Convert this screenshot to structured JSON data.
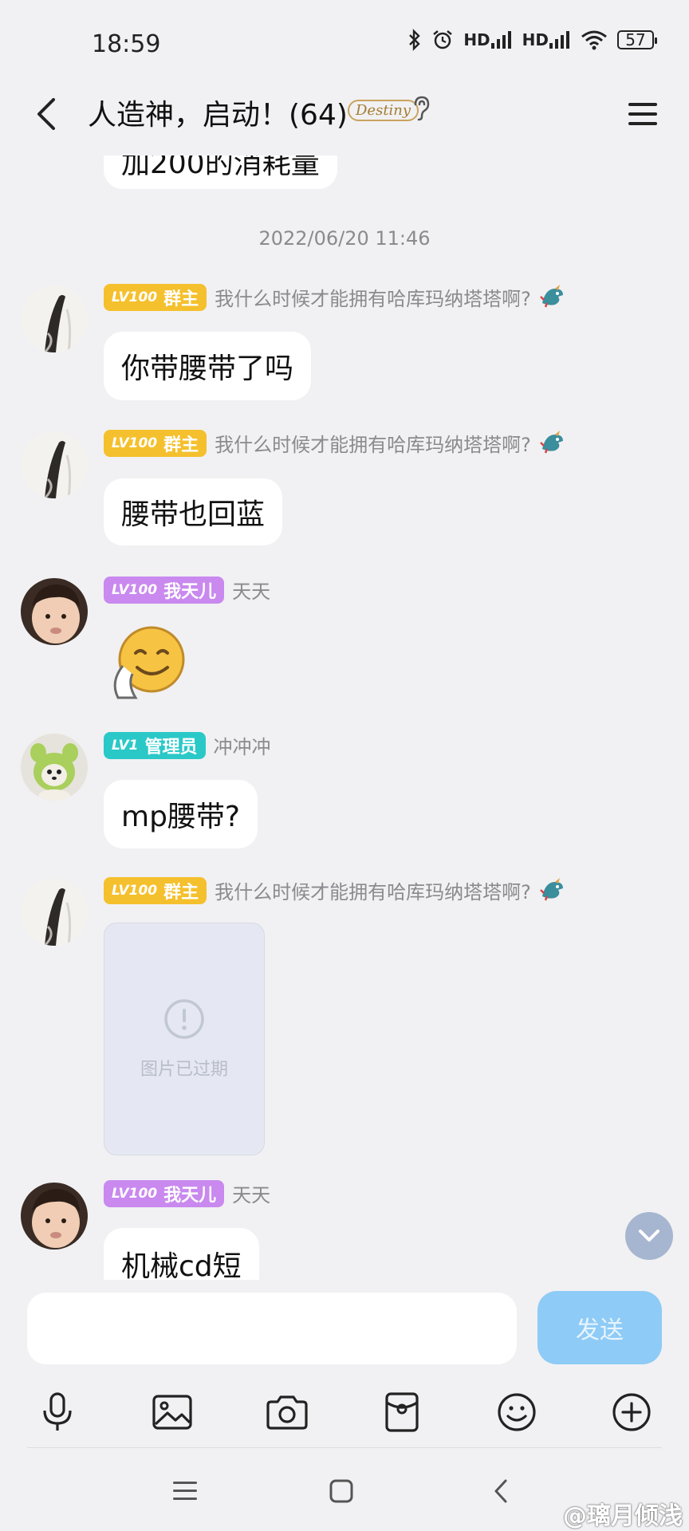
{
  "status_bar": {
    "time": "18:59",
    "signal_label_1": "HD",
    "signal_label_2": "HD",
    "battery": "57"
  },
  "header": {
    "title": "人造神，启动！(64)",
    "badge_text": "Destiny"
  },
  "messages": {
    "top_partial": "加200的消耗量",
    "timestamp": "2022/06/20 11:46",
    "m1": {
      "level": "LV100",
      "role": "群主",
      "nick": "我什么时候才能拥有哈库玛纳塔塔啊?",
      "text": "你带腰带了吗"
    },
    "m2": {
      "level": "LV100",
      "role": "群主",
      "nick": "我什么时候才能拥有哈库玛纳塔塔啊?",
      "text": "腰带也回蓝"
    },
    "m3": {
      "level": "LV100",
      "role": "我天儿",
      "nick": "天天"
    },
    "m4": {
      "level": "LV1",
      "role": "管理员",
      "nick": "冲冲冲",
      "text": "mp腰带?"
    },
    "m5": {
      "level": "LV100",
      "role": "群主",
      "nick": "我什么时候才能拥有哈库玛纳塔塔啊?",
      "expired_text": "图片已过期"
    },
    "m6": {
      "level": "LV100",
      "role": "我天儿",
      "nick": "天天",
      "text": "机械cd短"
    }
  },
  "input": {
    "placeholder": "",
    "send_label": "发送"
  },
  "toolbar_icons": [
    "mic-icon",
    "image-icon",
    "camera-icon",
    "red-packet-icon",
    "emoji-icon",
    "plus-icon"
  ],
  "watermark": "@璃月倾浅",
  "colors": {
    "background": "#f1f1f3",
    "owner_badge": "#f5c02d",
    "member_badge": "#c989ef",
    "admin_badge": "#2bc8c8",
    "send_button": "#8ecbf6"
  }
}
